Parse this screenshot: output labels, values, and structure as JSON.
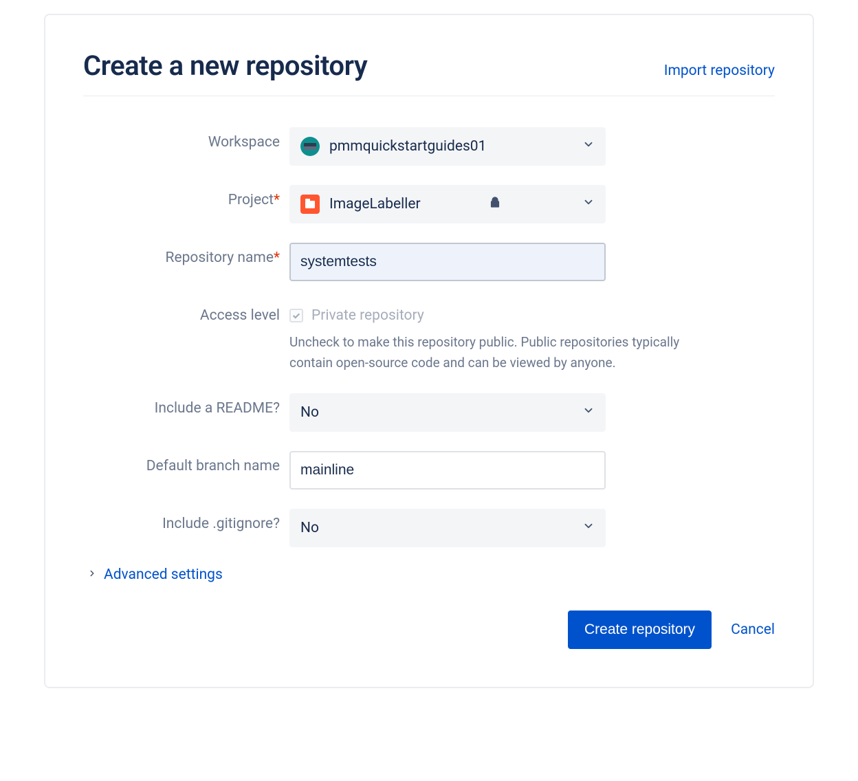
{
  "header": {
    "title": "Create a new repository",
    "import_link": "Import repository"
  },
  "labels": {
    "workspace": "Workspace",
    "project": "Project",
    "repo_name": "Repository name",
    "access_level": "Access level",
    "include_readme": "Include a README?",
    "default_branch": "Default branch name",
    "include_gitignore": "Include .gitignore?"
  },
  "fields": {
    "workspace_value": "pmmquickstartguides01",
    "project_value": "ImageLabeller",
    "repo_name_value": "systemtests",
    "access_checkbox_label": "Private repository",
    "access_help": "Uncheck to make this repository public. Public repositories typically contain open-source code and can be viewed by anyone.",
    "readme_value": "No",
    "default_branch_value": "mainline",
    "gitignore_value": "No"
  },
  "advanced": {
    "label": "Advanced settings"
  },
  "footer": {
    "create": "Create repository",
    "cancel": "Cancel"
  }
}
